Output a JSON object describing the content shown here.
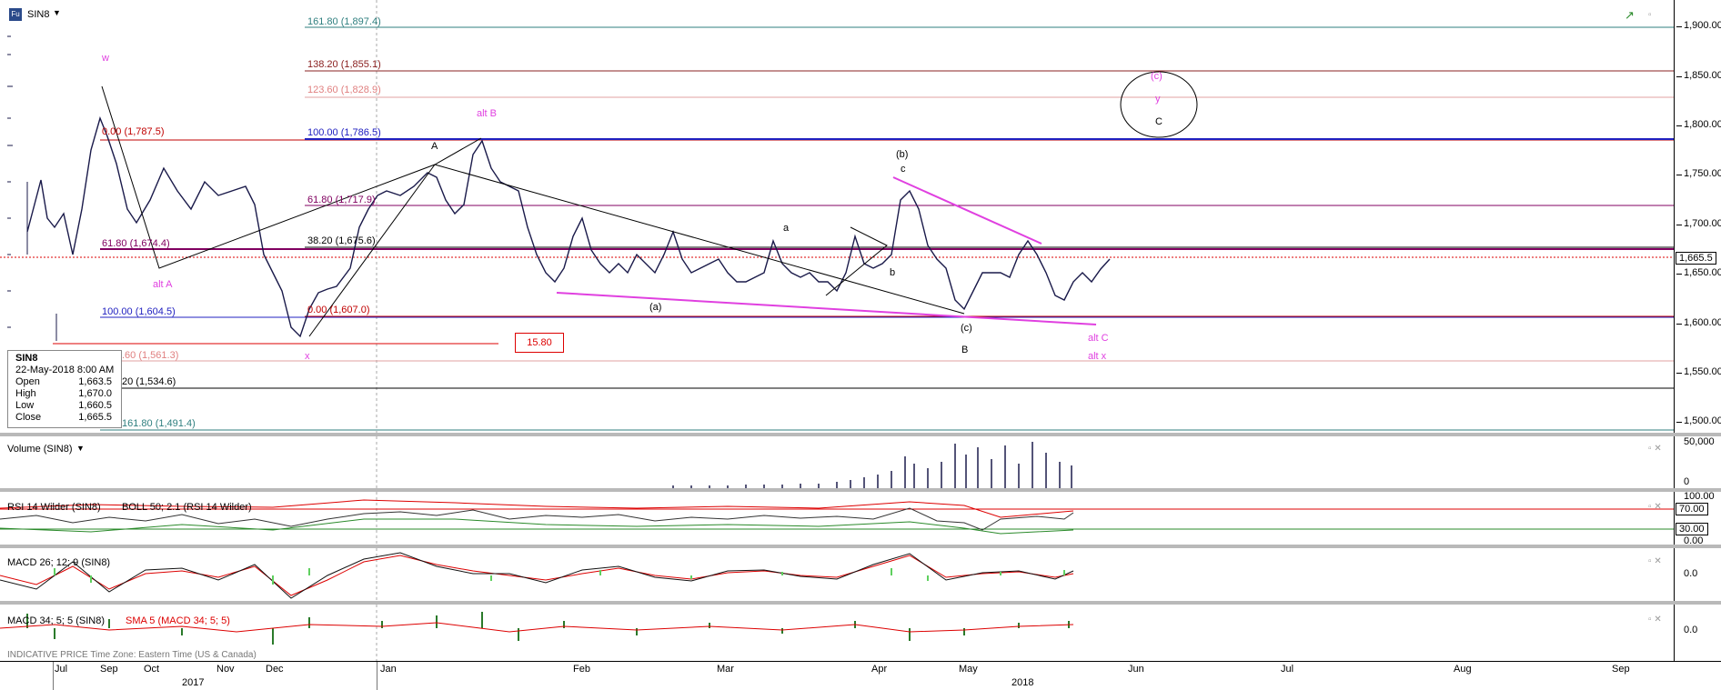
{
  "header": {
    "symbol": "SIN8",
    "symbol_icon": "fu-icon",
    "dropdown_icon": "chevron-down-icon"
  },
  "price_axis": {
    "labels": [
      "1,900.00",
      "1,850.00",
      "1,800.00",
      "1,750.00",
      "1,700.00",
      "1,650.00",
      "1,600.00",
      "1,550.00",
      "1,500.00"
    ],
    "current": "1,665.5"
  },
  "fib_labels": [
    {
      "text": "161.80 (1,897.4)",
      "color": "#2f7f7f"
    },
    {
      "text": "138.20 (1,855.1)",
      "color": "#8a2020"
    },
    {
      "text": "123.60 (1,828.9)",
      "color": "#e08080"
    },
    {
      "text": "100.00 (1,786.5)",
      "color": "#2020c0"
    },
    {
      "text": "0.00 (1,787.5)",
      "color": "#c00000"
    },
    {
      "text": "61.80 (1,717.9)",
      "color": "#800060"
    },
    {
      "text": "38.20 (1,675.6)",
      "color": "#000000"
    },
    {
      "text": "61.80 (1,674.4)",
      "color": "#800060"
    },
    {
      "text": "100.00 (1,604.5)",
      "color": "#2020c0"
    },
    {
      "text": "0.00 (1,607.0)",
      "color": "#c00000"
    },
    {
      "text": ".60 (1,561.3)",
      "color": "#e08080"
    },
    {
      "text": "20 (1,534.6)",
      "color": "#000000"
    },
    {
      "text": "161.80 (1,491.4)",
      "color": "#2f7f7f"
    }
  ],
  "wave_labels": {
    "w": "w",
    "alt_b": "alt B",
    "a_upper": "A",
    "alt_a": "alt A",
    "x": "x",
    "b_paren": "(b)",
    "c_small": "c",
    "a_small": "a",
    "b_small": "b",
    "a_paren": "(a)",
    "c_paren": "(c)",
    "B": "B",
    "alt_c": "alt C",
    "alt_x": "alt x",
    "c_circ": "(c)",
    "y": "y",
    "C": "C"
  },
  "red_box": "15.80",
  "ohlc": {
    "symbol": "SIN8",
    "datetime": "22-May-2018 8:00 AM",
    "rows": [
      {
        "k": "Open",
        "v": "1,663.5"
      },
      {
        "k": "High",
        "v": "1,670.0"
      },
      {
        "k": "Low",
        "v": "1,660.5"
      },
      {
        "k": "Close",
        "v": "1,665.5"
      }
    ]
  },
  "volume": {
    "title": "Volume (SIN8)",
    "labels": [
      "50,000",
      "0"
    ]
  },
  "rsi": {
    "title": "RSI 14 Wilder (SIN8)",
    "boll_title": "BOLL 50; 2.1 (RSI 14 Wilder)",
    "labels": [
      "100.00",
      "70.00",
      "30.00",
      "0.00"
    ]
  },
  "macd1": {
    "title": "MACD 26; 12; 9 (SIN8)",
    "labels": [
      "0.0"
    ]
  },
  "macd2": {
    "title": "MACD 34; 5; 5 (SIN8)",
    "sma_title": "SMA 5 (MACD 34; 5; 5)",
    "labels": [
      "0.0"
    ]
  },
  "time_axis": {
    "months": [
      "Jul",
      "Sep",
      "Oct",
      "Nov",
      "Dec",
      "Jan",
      "Feb",
      "Mar",
      "Apr",
      "May",
      "Jun",
      "Jul",
      "Aug",
      "Sep"
    ],
    "years": [
      "2017",
      "2018"
    ],
    "footer": "INDICATIVE PRICE  Time Zone: Eastern Time (US & Canada)"
  },
  "colors": {
    "candle": "#1a1a4a",
    "magenta": "#e040e0",
    "fib_purple": "#800060",
    "volume": "#1a1a4a"
  }
}
